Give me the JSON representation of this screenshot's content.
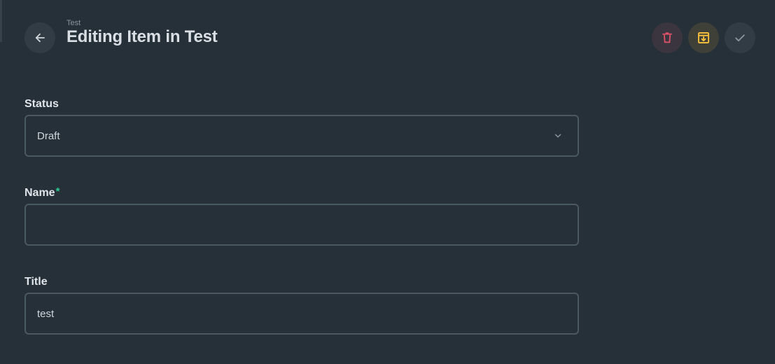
{
  "header": {
    "breadcrumb": "Test",
    "title": "Editing Item in Test",
    "back_icon": "arrow-left-icon"
  },
  "actions": [
    {
      "name": "delete",
      "icon": "trash-icon",
      "color": "#e35169"
    },
    {
      "name": "archive",
      "icon": "archive-icon",
      "color": "#ffc23b"
    },
    {
      "name": "save",
      "icon": "check-icon",
      "color": "#8a959e"
    }
  ],
  "form": {
    "status": {
      "label": "Status",
      "value": "Draft",
      "icon": "chevron-down-icon"
    },
    "name": {
      "label": "Name",
      "required_mark": "*",
      "value": ""
    },
    "title": {
      "label": "Title",
      "value": "test"
    }
  },
  "colors": {
    "background": "#263038",
    "accent_required": "#2ecc94",
    "border": "#4a5862"
  }
}
